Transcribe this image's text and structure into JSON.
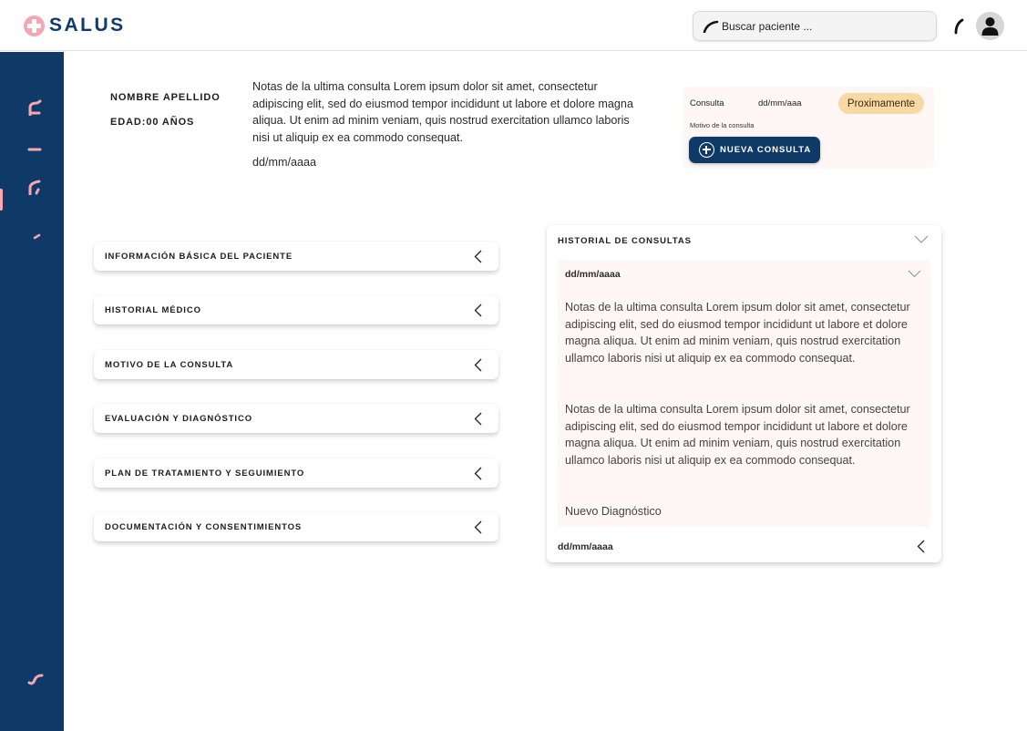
{
  "app": {
    "logo_text": "SALUS",
    "brand_color": "#0f3a68",
    "accent_color": "#f3a7b4"
  },
  "header": {
    "search_placeholder": "Buscar paciente ...",
    "icons": [
      "search-icon",
      "bell-icon",
      "user-avatar-icon"
    ]
  },
  "sidebar": {
    "items": [
      {
        "icon": "home-icon",
        "active": false
      },
      {
        "icon": "patients-icon",
        "active": true
      },
      {
        "icon": "calendar-icon",
        "active": false
      },
      {
        "icon": "reports-icon",
        "active": false
      },
      {
        "icon": "logout-icon",
        "active": false
      }
    ]
  },
  "patient": {
    "name": "NOMBRE APELLIDO",
    "age": "EDAD:00 AÑOS",
    "last_notes": "Notas de la ultima consulta Lorem ipsum dolor sit amet, consectetur adipiscing elit, sed do eiusmod tempor incididunt ut labore et dolore magna aliqua. Ut enim ad minim veniam, quis nostrud exercitation ullamco laboris nisi ut aliquip ex ea commodo consequat.",
    "last_date": "dd/mm/aaaa"
  },
  "consulta_card": {
    "label": "Consulta",
    "date": "dd/mm/aaa",
    "status": "Proximamente",
    "status_color": "#f9d9a3",
    "motivo_label": "Motivo de la consulta",
    "button_label": "NUEVA CONSULTA"
  },
  "sections": [
    {
      "title": "INFORMACIÓN BÁSICA DEL PACIENTE"
    },
    {
      "title": "HISTORIAL MÉDICO"
    },
    {
      "title": "MOTIVO DE LA CONSULTA"
    },
    {
      "title": "EVALUACIÓN Y DIAGNÓSTICO"
    },
    {
      "title": "PLAN DE TRATAMIENTO Y SEGUIMIENTO"
    },
    {
      "title": "DOCUMENTACIÓN Y CONSENTIMIENTOS"
    }
  ],
  "historial": {
    "title": "HISTORIAL DE CONSULTAS",
    "expanded_item": {
      "date": "dd/mm/aaaa",
      "notes": [
        "Notas de la ultima consulta Lorem ipsum dolor sit amet, consectetur adipiscing elit, sed do eiusmod tempor incididunt ut labore et dolore magna aliqua. Ut enim ad minim veniam, quis nostrud exercitation ullamco laboris nisi ut aliquip ex ea commodo consequat.",
        "Notas de la ultima consulta Lorem ipsum dolor sit amet, consectetur adipiscing elit, sed do eiusmod tempor incididunt ut labore et dolore magna aliqua. Ut enim ad minim veniam, quis nostrud exercitation ullamco laboris nisi ut aliquip ex ea commodo consequat."
      ],
      "diagnosis": "Nuevo Diagnóstico"
    },
    "collapsed_item": {
      "date": "dd/mm/aaaa"
    }
  }
}
